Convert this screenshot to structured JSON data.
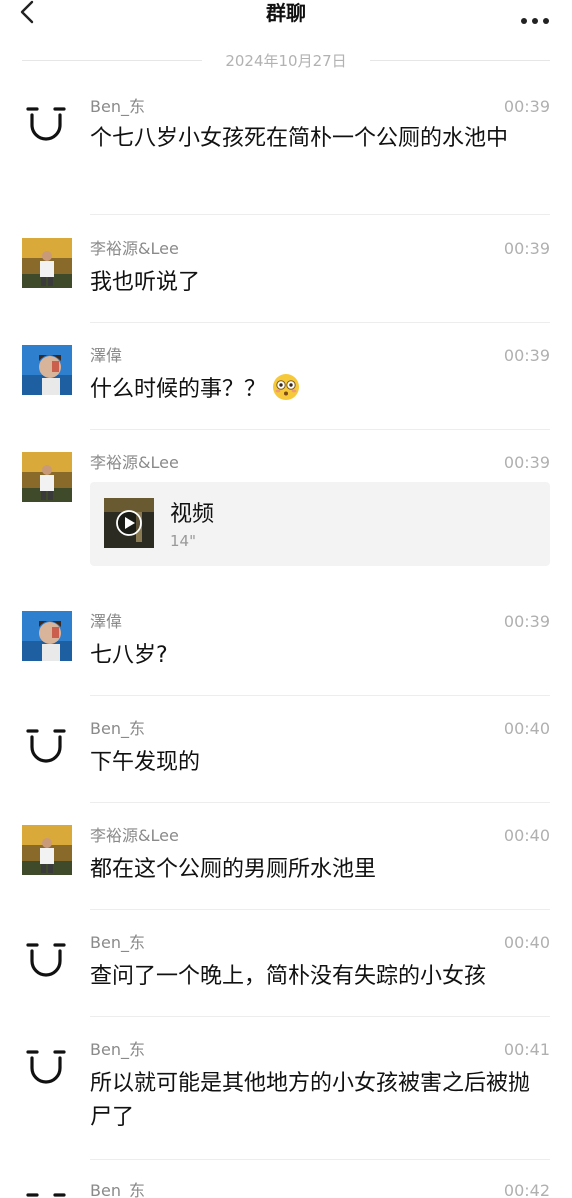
{
  "header": {
    "title": "群聊"
  },
  "date_divider": "2024年10月27日",
  "messages": [
    {
      "sender": "Ben_东",
      "time": "00:39",
      "text": "个七八岁小女孩死在简朴一个公厕的水池中"
    },
    {
      "sender": "李裕源&Lee",
      "time": "00:39",
      "text": "我也听说了"
    },
    {
      "sender": "澤偉",
      "time": "00:39",
      "text": "什么时候的事？？"
    },
    {
      "sender": "李裕源&Lee",
      "time": "00:39",
      "video_title": "视频",
      "video_duration": "14\""
    },
    {
      "sender": "澤偉",
      "time": "00:39",
      "text": "七八岁?"
    },
    {
      "sender": "Ben_东",
      "time": "00:40",
      "text": "下午发现的"
    },
    {
      "sender": "李裕源&Lee",
      "time": "00:40",
      "text": "都在这个公厕的男厕所水池里"
    },
    {
      "sender": "Ben_东",
      "time": "00:40",
      "text": "查问了一个晚上，简朴没有失踪的小女孩"
    },
    {
      "sender": "Ben_东",
      "time": "00:41",
      "text": "所以就可能是其他地方的小女孩被害之后被抛尸了"
    },
    {
      "sender": "Ben_东",
      "time": "00:42",
      "text": ""
    }
  ],
  "icons": {
    "back": "chevron-left-icon",
    "more": "more-dots-icon",
    "emoji": "flushed-face-emoji",
    "play": "play-icon"
  }
}
